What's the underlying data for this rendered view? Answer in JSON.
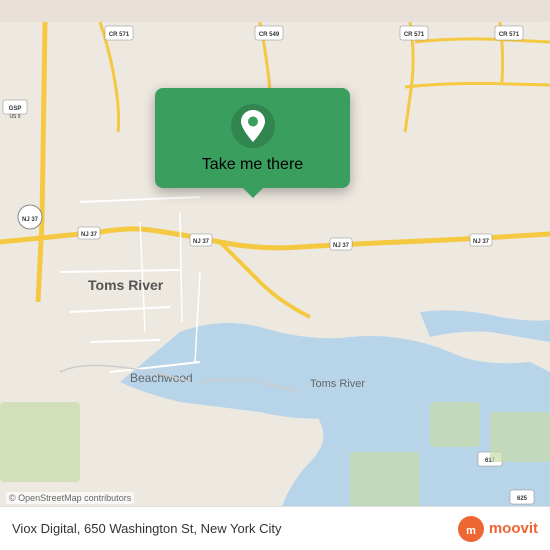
{
  "map": {
    "background_color": "#e8e0d8",
    "attribution": "© OpenStreetMap contributors",
    "location": "Toms River, NJ"
  },
  "popup": {
    "label": "Take me there",
    "pin_color": "#ffffff"
  },
  "bottom_bar": {
    "address": "Viox Digital, 650 Washington St, New York City",
    "logo_text": "moovit"
  }
}
